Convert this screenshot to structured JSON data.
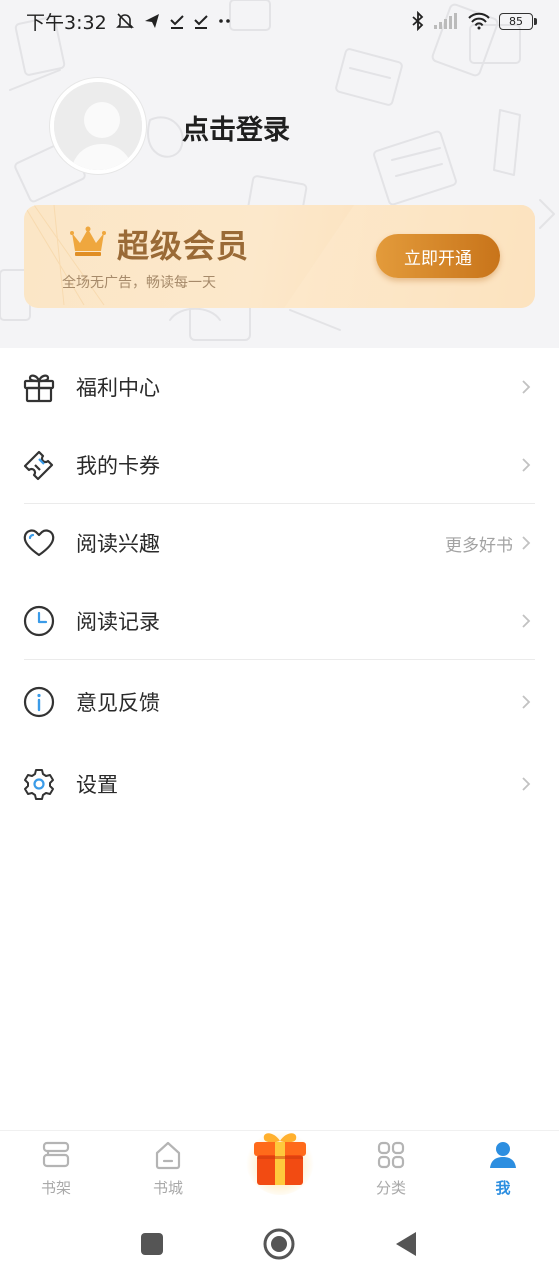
{
  "status_bar": {
    "time": "下午3:32",
    "battery": "85"
  },
  "profile": {
    "login_text": "点击登录"
  },
  "vip": {
    "title": "超级会员",
    "subtitle": "全场无广告，畅读每一天",
    "button_label": "立即开通"
  },
  "menu": {
    "items": [
      {
        "label": "福利中心",
        "icon": "gift-icon"
      },
      {
        "label": "我的卡券",
        "icon": "ticket-icon"
      },
      {
        "label": "阅读兴趣",
        "icon": "heart-icon",
        "extra": "更多好书"
      },
      {
        "label": "阅读记录",
        "icon": "clock-icon"
      },
      {
        "label": "意见反馈",
        "icon": "info-icon"
      },
      {
        "label": "设置",
        "icon": "gear-icon"
      }
    ]
  },
  "bottom_nav": {
    "items": [
      {
        "label": "书架",
        "icon": "bookshelf-icon"
      },
      {
        "label": "书城",
        "icon": "bookstore-icon"
      },
      {
        "label": "分类",
        "icon": "category-icon"
      },
      {
        "label": "我",
        "icon": "profile-icon"
      }
    ],
    "active_index": 3,
    "active_color": "#2c8ee0",
    "inactive_color": "#a9a9a9"
  },
  "colors": {
    "vip_title": "#9a6a36",
    "vip_button": "#d4832a",
    "header_bg": "#f4f4f6"
  }
}
